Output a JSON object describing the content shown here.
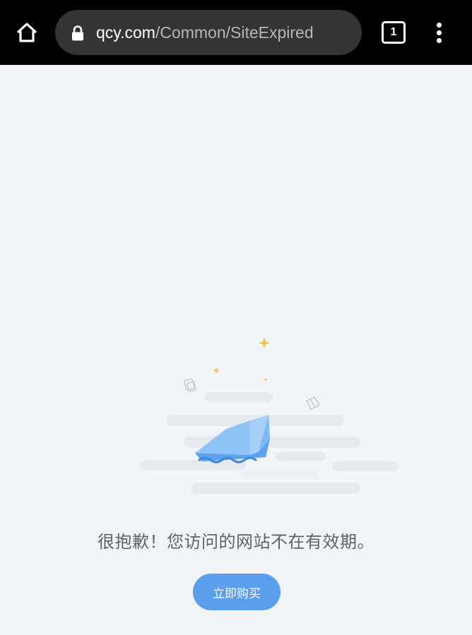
{
  "browser": {
    "url_domain": "qcy.com",
    "url_path": "/Common/SiteExpired",
    "tab_count": "1",
    "icons": {
      "home": "home-icon",
      "lock": "lock-icon",
      "tabs": "tab-switcher-icon",
      "menu": "more-vert-icon"
    }
  },
  "page": {
    "message": "很抱歉！您访问的网站不在有效期。",
    "buy_button_label": "立即购买"
  },
  "colors": {
    "browser_bar": "#000000",
    "url_field": "#333436",
    "page_background": "#f1f4f8",
    "button": "#5b9ee9",
    "message_text": "#606266",
    "boat": "#7fb8f5",
    "sparkle": "#f5c24a"
  }
}
